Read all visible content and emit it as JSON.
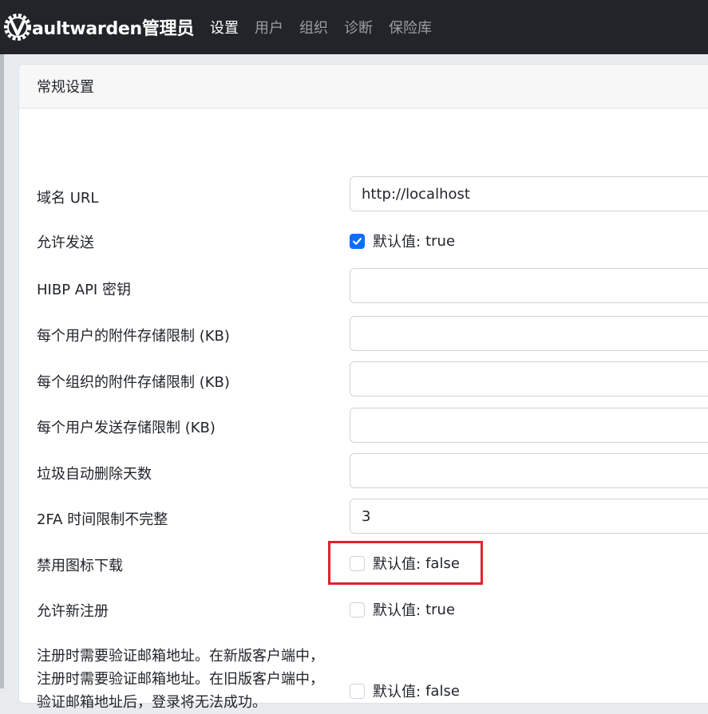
{
  "navbar": {
    "brand": "aultwarden管理员",
    "links": [
      "设置",
      "用户",
      "组织",
      "诊断",
      "保险库"
    ]
  },
  "card": {
    "title": "常规设置",
    "settings": [
      {
        "label": "域名 URL",
        "type": "input",
        "value": "http://localhost"
      },
      {
        "label": "允许发送",
        "type": "checkbox",
        "checked": true,
        "default_label": "默认值:",
        "default_value": "true"
      },
      {
        "label": "HIBP API 密钥",
        "type": "input",
        "value": ""
      },
      {
        "label": "每个用户的附件存储限制 (KB)",
        "type": "input",
        "value": ""
      },
      {
        "label": "每个组织的附件存储限制 (KB)",
        "type": "input",
        "value": ""
      },
      {
        "label": "每个用户发送存储限制 (KB)",
        "type": "input",
        "value": ""
      },
      {
        "label": "垃圾自动删除天数",
        "type": "input",
        "value": ""
      },
      {
        "label": "2FA 时间限制不完整",
        "type": "input",
        "value": "3"
      },
      {
        "label": "禁用图标下载",
        "type": "checkbox",
        "checked": false,
        "default_label": "默认值:",
        "default_value": "false"
      },
      {
        "label": "允许新注册",
        "type": "checkbox",
        "checked": false,
        "default_label": "默认值:",
        "default_value": "true"
      },
      {
        "label": "注册时需要验证邮箱地址。在新版客户端中，注册时需要验证邮箱地址。在旧版客户端中，验证邮箱地址后，登录将无法成功。",
        "type": "checkbox",
        "checked": false,
        "default_label": "默认值:",
        "default_value": "false"
      }
    ]
  },
  "colors": {
    "navbar_bg": "#212529",
    "accent": "#0d6efd",
    "highlight": "#e0232e"
  }
}
